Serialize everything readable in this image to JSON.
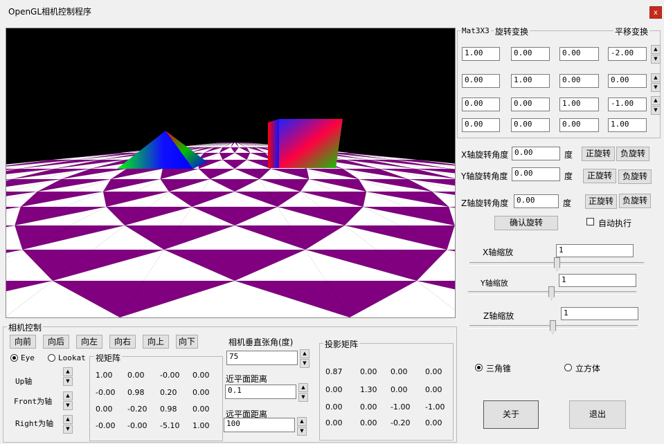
{
  "window": {
    "title": "OpenGL相机控制程序",
    "close_label": "x"
  },
  "mat": {
    "group_label": "Mat3X3",
    "rotate_label": "旋转变换",
    "translate_label": "平移变换",
    "rows": [
      [
        "1.00",
        "0.00",
        "0.00",
        "-2.00"
      ],
      [
        "0.00",
        "1.00",
        "0.00",
        "0.00"
      ],
      [
        "0.00",
        "0.00",
        "1.00",
        "-1.00"
      ],
      [
        "0.00",
        "0.00",
        "0.00",
        "1.00"
      ]
    ]
  },
  "rotation": {
    "x_label": "X轴旋转角度",
    "x_value": "0.00",
    "y_label": "Y轴旋转角度",
    "y_value": "0.00",
    "z_label": "Z轴旋转角度",
    "z_value": "0.00",
    "unit": "度",
    "pos_label": "正旋转",
    "neg_label": "负旋转",
    "confirm_label": "确认旋转",
    "auto_label": "自动执行"
  },
  "scale": {
    "x_label": "X轴缩放",
    "x_value": "1",
    "y_label": "Y轴缩放",
    "y_value": "1",
    "z_label": "Z轴缩放",
    "z_value": "1"
  },
  "shape": {
    "pyramid_label": "三角锥",
    "cube_label": "立方体",
    "selected": "pyramid"
  },
  "actions": {
    "about_label": "关于",
    "exit_label": "退出"
  },
  "camera": {
    "group_label": "相机控制",
    "move_buttons": [
      "向前",
      "向后",
      "向左",
      "向右",
      "向上",
      "向下"
    ],
    "eye_label": "Eye",
    "lookat_label": "Lookat",
    "axes": [
      "Up轴",
      "Front为轴",
      "Right为轴"
    ]
  },
  "view_matrix": {
    "label": "视矩阵",
    "rows": [
      [
        "1.00",
        "0.00",
        "-0.00",
        "0.00"
      ],
      [
        "-0.00",
        "0.98",
        "0.20",
        "0.00"
      ],
      [
        "0.00",
        "-0.20",
        "0.98",
        "0.00"
      ],
      [
        "-0.00",
        "-0.00",
        "-5.10",
        "1.00"
      ]
    ]
  },
  "fov": {
    "label": "相机垂直张角(度)",
    "value": "75"
  },
  "near": {
    "label": "近平面距离",
    "value": "0.1"
  },
  "far": {
    "label": "远平面距离",
    "value": "100"
  },
  "proj_matrix": {
    "label": "投影矩阵",
    "rows": [
      [
        "0.87",
        "0.00",
        "0.00",
        "0.00"
      ],
      [
        "0.00",
        "1.30",
        "0.00",
        "0.00"
      ],
      [
        "0.00",
        "0.00",
        "-1.00",
        "-1.00"
      ],
      [
        "0.00",
        "0.00",
        "-0.20",
        "0.00"
      ]
    ]
  },
  "colors": {
    "floor": "#800080",
    "window_bg": "#f0f0f0",
    "close_red": "#c42b1c"
  }
}
